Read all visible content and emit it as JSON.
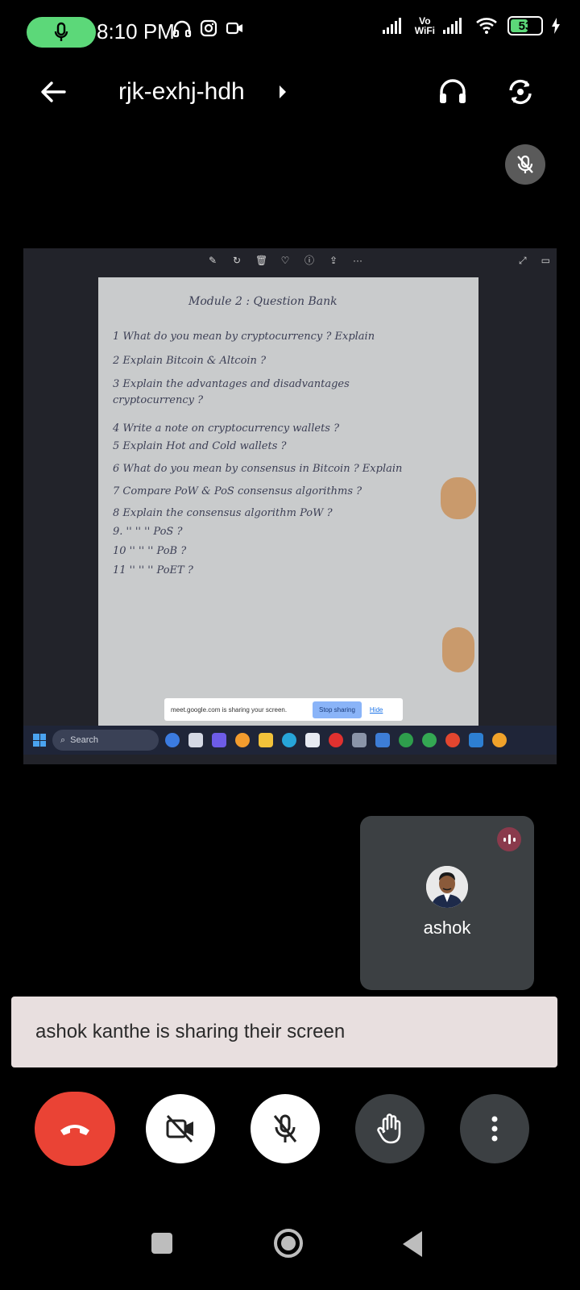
{
  "status_bar": {
    "time": "8:10 PM",
    "network_label_1": "Vo",
    "network_label_2": "WiFi",
    "battery_level": "53",
    "battery_fraction": 0.53,
    "recording_pill_color": "#5cd879"
  },
  "app_bar": {
    "meeting_code": "rjk-exhj-hdh",
    "back_icon": "arrow-left-icon",
    "title_chevron_icon": "chevron-right-icon",
    "audio_icon": "headphones-icon",
    "switch_camera_icon": "switch-camera-icon"
  },
  "shared_screen": {
    "paper": {
      "title": "Module 2 : Question Bank",
      "lines": [
        "1  What do you mean by cryptocurrency ? Explain",
        "2  Explain Bitcoin & Altcoin ?",
        "3  Explain the advantages and disadvantages",
        "    cryptocurrency ?",
        "4  Write a note on cryptocurrency wallets ?",
        "5  Explain Hot and Cold wallets ?",
        "6  What do you mean by consensus in Bitcoin ? Explain",
        "7  Compare PoW & PoS consensus algorithms ?",
        "8  Explain the consensus algorithm PoW ?",
        "9.      ''        ''          ''       PoS ?",
        "10      ''        ''          ''       PoB ?",
        "11      ''        ''          ''       PoET ?"
      ]
    },
    "share_notice": {
      "text": "meet.google.com is sharing your screen.",
      "stop_label": "Stop sharing",
      "hide_label": "Hide"
    },
    "taskbar": {
      "search_label": "Search"
    }
  },
  "self_view": {
    "name": "ashok",
    "audio_indicator_color": "#8a3a4c"
  },
  "toast": {
    "message": "ashok kanthe is sharing their screen"
  },
  "controls": {
    "end_call_color": "#ea4335",
    "end_call_icon": "phone-hangup-icon",
    "camera_icon": "camera-off-icon",
    "mic_icon": "mic-off-icon",
    "hand_icon": "raise-hand-icon",
    "more_icon": "more-vertical-icon"
  }
}
